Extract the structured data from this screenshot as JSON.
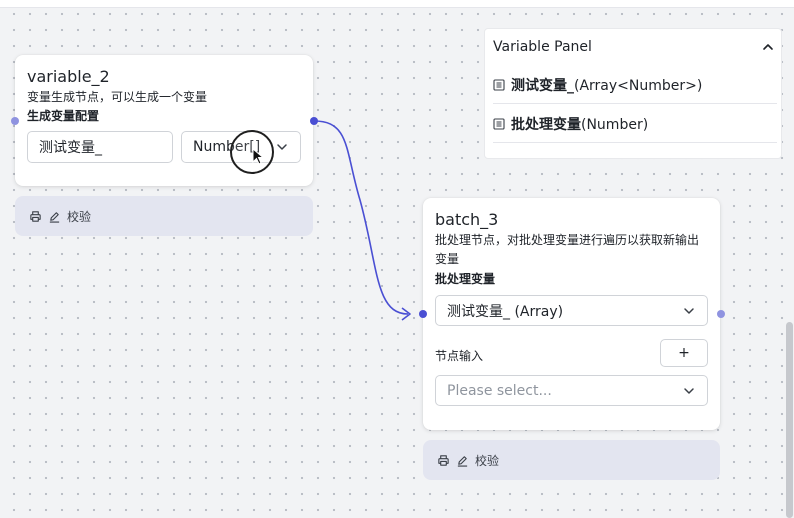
{
  "colors": {
    "accent": "#4a4fd3",
    "handle_muted": "#8f93e0",
    "footer_bg": "#e3e5f0"
  },
  "variable_panel": {
    "title": "Variable Panel",
    "items": [
      {
        "name": "测试变量_",
        "type": "(Array<Number>)",
        "icon": "list-icon"
      },
      {
        "name": "批处理变量",
        "type": "(Number)",
        "icon": "list-icon"
      }
    ]
  },
  "variable_node": {
    "title": "variable_2",
    "description": "变量生成节点，可以生成一个变量",
    "config_label": "生成变量配置",
    "name_value": "测试变量_",
    "type_value": "Number[]",
    "footer_label": "校验"
  },
  "batch_node": {
    "title": "batch_3",
    "description_line1": "批处理节点，对批处理变量进行遍历以获取新输出",
    "description_line2": "变量",
    "batch_label": "批处理变量",
    "batch_value": "测试变量_ (Array)",
    "input_label": "节点输入",
    "add_label": "+",
    "select_placeholder": "Please select...",
    "footer_label": "校验"
  }
}
